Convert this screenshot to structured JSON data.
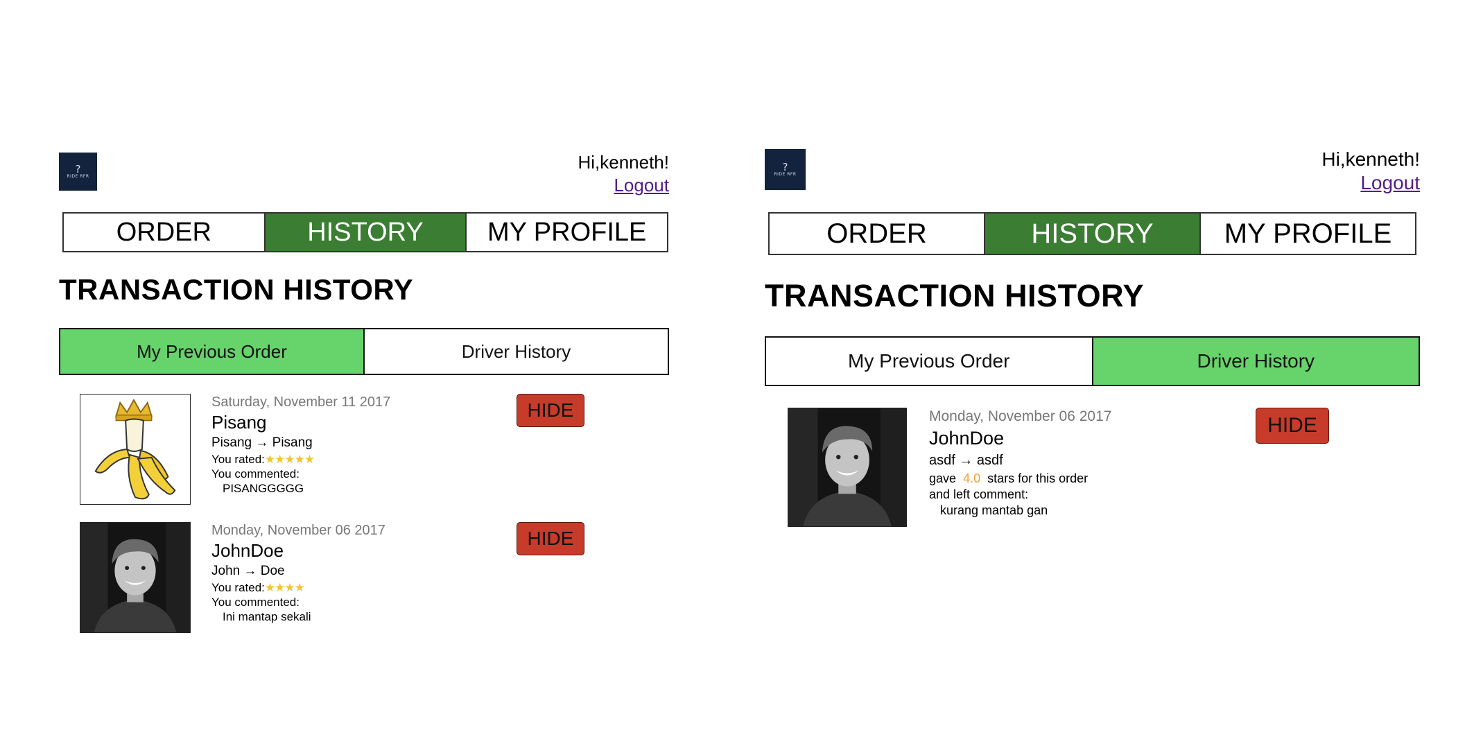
{
  "header": {
    "logo_mark": "?",
    "logo_text": "RIDE RFR",
    "greeting": "Hi,kenneth!",
    "logout_label": "Logout"
  },
  "nav": {
    "order": "ORDER",
    "history": "HISTORY",
    "profile": "MY PROFILE",
    "active_color": "#3a7d33"
  },
  "page_title": "TRANSACTION HISTORY",
  "subtabs": {
    "previous_order": "My Previous Order",
    "driver_history": "Driver History",
    "active_color": "#66d36b"
  },
  "hide_label": "HIDE",
  "previous_orders": [
    {
      "date": "Saturday, November 11 2017",
      "name": "Pisang",
      "route": "Pisang → Pisang",
      "rated_label": "You rated:",
      "stars": "★★★★★",
      "rating": 5,
      "commented_label": "You commented:",
      "comment": "PISANGGGGG",
      "avatar": "crowned-banana-image"
    },
    {
      "date": "Monday, November 06 2017",
      "name": "JohnDoe",
      "route": "John → Doe",
      "rated_label": "You rated:",
      "stars": "★★★★",
      "rating": 4,
      "commented_label": "You commented:",
      "comment": "Ini mantap sekali",
      "avatar": "smiling-man-photo"
    }
  ],
  "driver_history": [
    {
      "date": "Monday, November 06 2017",
      "name": "JohnDoe",
      "route": "asdf → asdf",
      "gave_label": "gave",
      "rating": "4.0",
      "stars_suffix": "stars for this order",
      "left_comment_label": "and left comment:",
      "comment": "kurang mantab gan",
      "avatar": "smiling-man-photo"
    }
  ]
}
